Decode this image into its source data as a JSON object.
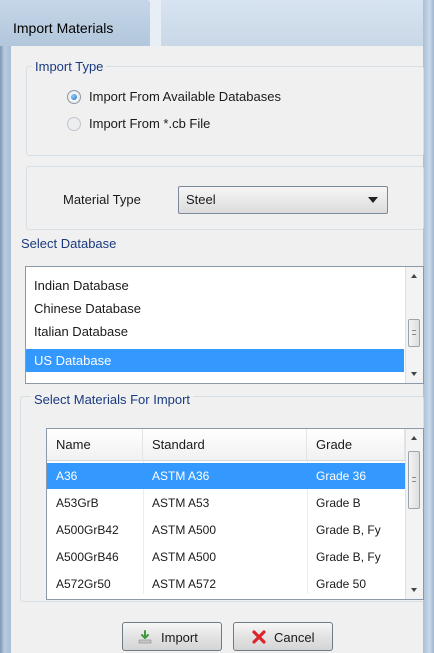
{
  "window": {
    "title": "Import Materials"
  },
  "import_type": {
    "label": "Import Type",
    "options": [
      {
        "label": "Import From Available Databases",
        "checked": true
      },
      {
        "label": "Import From *.cb File",
        "checked": false
      }
    ]
  },
  "material_type": {
    "label": "Material Type",
    "value": "Steel"
  },
  "select_database": {
    "label": "Select Database",
    "items": [
      "Indian Database",
      "Chinese Database",
      "Italian Database",
      "US Database"
    ],
    "selected": "US Database"
  },
  "select_materials": {
    "label": "Select Materials For Import",
    "columns": [
      "Name",
      "Standard",
      "Grade"
    ],
    "rows": [
      {
        "name": "A36",
        "standard": "ASTM A36",
        "grade": "Grade 36"
      },
      {
        "name": "A53GrB",
        "standard": "ASTM A53",
        "grade": "Grade B"
      },
      {
        "name": "A500GrB42",
        "standard": "ASTM A500",
        "grade": "Grade B, Fy"
      },
      {
        "name": "A500GrB46",
        "standard": "ASTM A500",
        "grade": "Grade B, Fy"
      },
      {
        "name": "A572Gr50",
        "standard": "ASTM A572",
        "grade": "Grade 50"
      }
    ],
    "selected_row": 0
  },
  "buttons": {
    "import": "Import",
    "cancel": "Cancel"
  },
  "colors": {
    "selection": "#3399ff",
    "group_label": "#1a3a80",
    "cancel_icon": "#d9262b",
    "import_icon": "#4caf50"
  },
  "icons": {
    "import": "import-arrow-icon",
    "cancel": "red-x-icon",
    "chevron": "chevron-down-icon"
  }
}
